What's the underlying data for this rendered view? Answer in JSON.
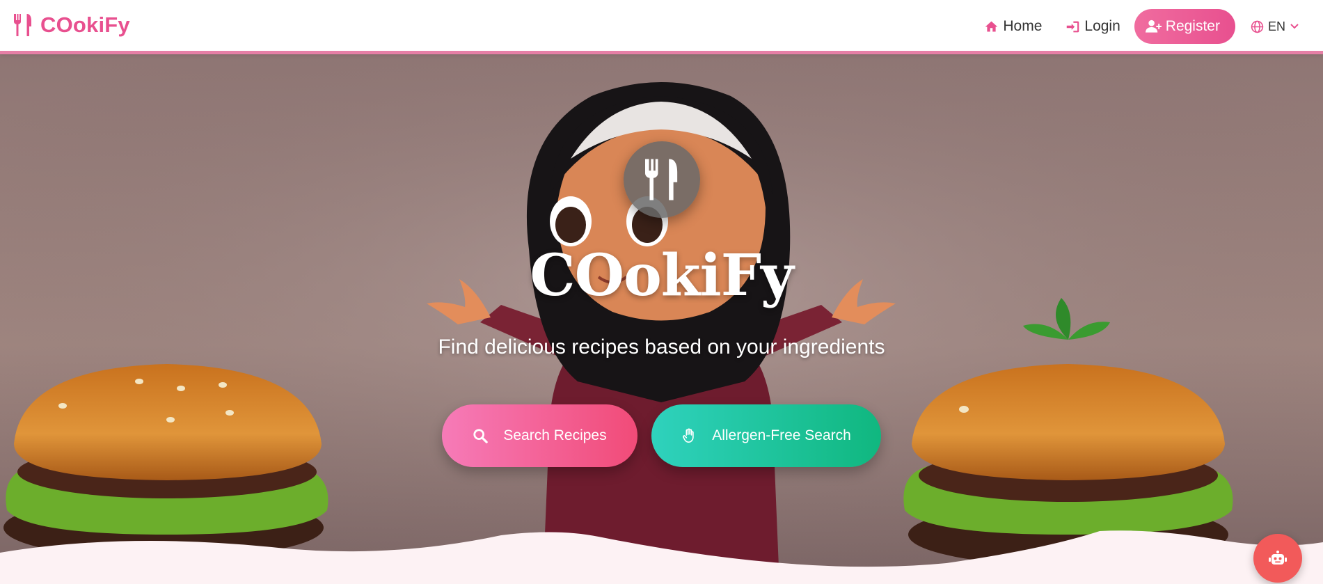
{
  "brand": {
    "name": "COokiFy",
    "icon": "utensils-icon"
  },
  "nav": {
    "home": "Home",
    "login": "Login",
    "register": "Register",
    "language": "EN"
  },
  "hero": {
    "title": "COokiFy",
    "subtitle": "Find delicious recipes based on your ingredients",
    "search_button": "Search Recipes",
    "allergen_button": "Allergen-Free Search"
  },
  "chatbot": {
    "icon": "robot-icon"
  },
  "colors": {
    "brand_pink": "#e8508f",
    "search_gradient": [
      "#f67bb8",
      "#f14b78"
    ],
    "allergen_gradient": [
      "#2fd2bd",
      "#10b77f"
    ],
    "chat_red": "#f25a5a",
    "page_bg": "#fdf2f4"
  }
}
